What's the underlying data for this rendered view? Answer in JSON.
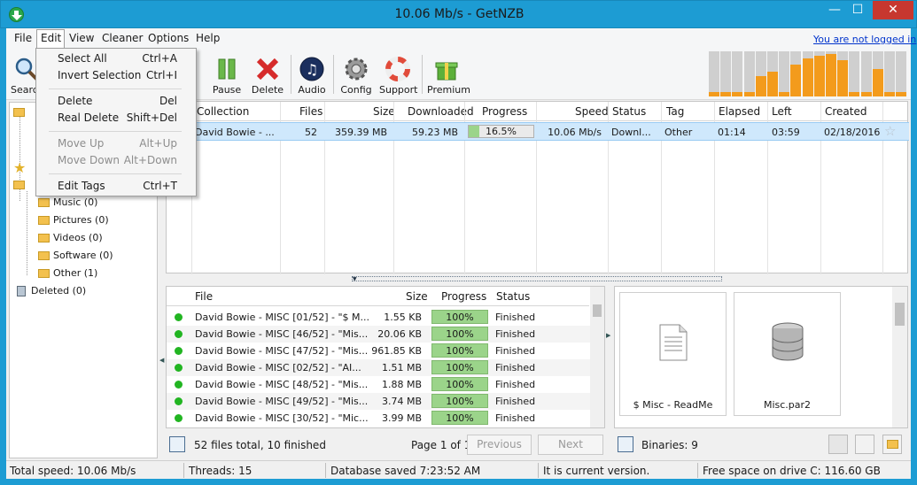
{
  "window": {
    "title": "10.06 Mb/s - GetNZB",
    "min": "—",
    "max": "☐",
    "close": "✕"
  },
  "menubar": {
    "items": [
      "File",
      "Edit",
      "View",
      "Cleaner",
      "Options",
      "Help"
    ],
    "login_link": "You are not logged in"
  },
  "toolbar": {
    "buttons": [
      "Search",
      "Pause",
      "Delete",
      "Audio",
      "Config",
      "Support",
      "Premium"
    ]
  },
  "edit_menu": {
    "items": [
      {
        "label": "Select All",
        "shortcut": "Ctrl+A",
        "enabled": true
      },
      {
        "label": "Invert Selection",
        "shortcut": "Ctrl+I",
        "enabled": true
      },
      {
        "label": "Delete",
        "shortcut": "Del",
        "enabled": true
      },
      {
        "label": "Real Delete",
        "shortcut": "Shift+Del",
        "enabled": true
      },
      {
        "label": "Move Up",
        "shortcut": "Alt+Up",
        "enabled": false
      },
      {
        "label": "Move Down",
        "shortcut": "Alt+Down",
        "enabled": false
      },
      {
        "label": "Edit Tags",
        "shortcut": "Ctrl+T",
        "enabled": true
      }
    ]
  },
  "sidebar": {
    "categories": [
      "Music (0)",
      "Pictures (0)",
      "Videos (0)",
      "Software (0)",
      "Other (1)"
    ],
    "deleted": "Deleted (0)"
  },
  "collections": {
    "columns": [
      "Collection",
      "Files",
      "Size",
      "Downloaded",
      "Progress",
      "Speed",
      "Status",
      "Tag",
      "Elapsed",
      "Left",
      "Created"
    ],
    "rows": [
      {
        "collection": "David Bowie - ...",
        "files": "52",
        "size": "359.39 MB",
        "downloaded": "59.23 MB",
        "progress": "16.5%",
        "progress_value": 16.5,
        "speed": "10.06 Mb/s",
        "status": "Downl...",
        "tag": "Other",
        "elapsed": "01:14",
        "left": "03:59",
        "created": "02/18/2016"
      }
    ]
  },
  "files": {
    "columns": [
      "File",
      "Size",
      "Progress",
      "Status"
    ],
    "rows": [
      {
        "name": "David Bowie - MISC [01/52] - \"$ M...",
        "size": "1.55 KB",
        "progress": "100%",
        "status": "Finished"
      },
      {
        "name": "David Bowie - MISC [46/52] - \"Mis...",
        "size": "20.06 KB",
        "progress": "100%",
        "status": "Finished"
      },
      {
        "name": "David Bowie - MISC [47/52] - \"Mis...",
        "size": "961.85 KB",
        "progress": "100%",
        "status": "Finished"
      },
      {
        "name": "David Bowie - MISC [02/52] - \"AI...",
        "size": "1.51 MB",
        "progress": "100%",
        "status": "Finished"
      },
      {
        "name": "David Bowie - MISC [48/52] - \"Mis...",
        "size": "1.88 MB",
        "progress": "100%",
        "status": "Finished"
      },
      {
        "name": "David Bowie - MISC [49/52] - \"Mis...",
        "size": "3.74 MB",
        "progress": "100%",
        "status": "Finished"
      },
      {
        "name": "David Bowie - MISC [30/52] - \"Mic...",
        "size": "3.99 MB",
        "progress": "100%",
        "status": "Finished"
      }
    ],
    "summary": "52 files total, 10 finished",
    "page": "Page 1 of 1",
    "prev": "Previous",
    "next": "Next"
  },
  "binaries": {
    "label": "Binaries: 9",
    "items": [
      "$ Misc - ReadMe",
      "Misc.par2"
    ]
  },
  "status_bar": {
    "speed": "Total speed: 10.06 Mb/s",
    "threads": "Threads: 15",
    "db": "Database saved 7:23:52 AM",
    "version": "It is current version.",
    "disk": "Free space on drive C: 116.60 GB"
  }
}
